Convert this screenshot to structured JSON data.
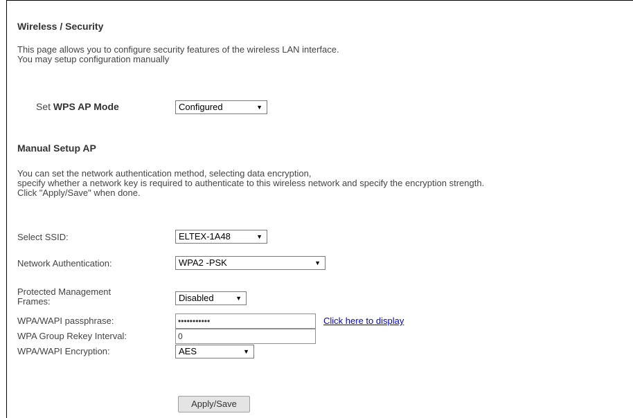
{
  "page": {
    "title": "Wireless / Security",
    "intro_line1": "This page allows you to configure security features of the wireless LAN interface.",
    "intro_line2": "You may setup configuration manually"
  },
  "wps": {
    "label_prefix": "Set",
    "label_bold": "WPS AP Mode",
    "value": "Configured"
  },
  "manual": {
    "heading": "Manual Setup AP",
    "desc_line1": "You can set the network authentication method, selecting data encryption,",
    "desc_line2": "specify whether a network key is required to authenticate to this wireless network and specify the encryption strength.",
    "desc_line3": "Click \"Apply/Save\" when done."
  },
  "fields": {
    "ssid_label": "Select SSID:",
    "ssid_value": "ELTEX-1A48",
    "auth_label": "Network Authentication:",
    "auth_value": "WPA2 -PSK",
    "pmf_label_line1": "Protected Management",
    "pmf_label_line2": "Frames:",
    "pmf_value": "Disabled",
    "pass_label": "WPA/WAPI passphrase:",
    "pass_value": "•••••••••••",
    "display_link": "Click here to display",
    "rekey_label": "WPA Group Rekey Interval:",
    "rekey_value": "0",
    "enc_label": "WPA/WAPI Encryption:",
    "enc_value": "AES"
  },
  "actions": {
    "apply_label": "Apply/Save"
  }
}
